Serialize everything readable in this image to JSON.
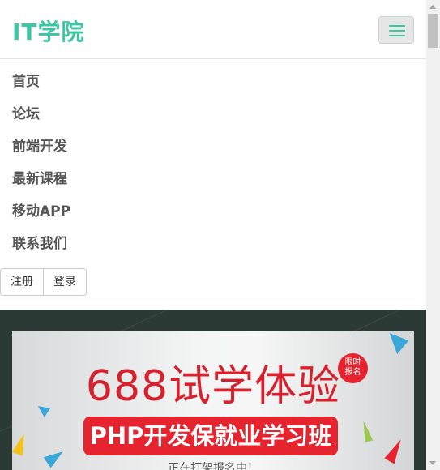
{
  "brand": {
    "title": "IT学院"
  },
  "navbar": {
    "toggle_label": ""
  },
  "menu": {
    "items": [
      {
        "label": "首页"
      },
      {
        "label": "论坛"
      },
      {
        "label": "前端开发"
      },
      {
        "label": "最新课程"
      },
      {
        "label": "移动APP"
      },
      {
        "label": "联系我们"
      }
    ]
  },
  "auth": {
    "register_label": "注册",
    "login_label": "登录"
  },
  "banner": {
    "headline": "688试学体验",
    "badge_line1": "限时",
    "badge_line2": "报名",
    "pill_text": "PHP开发保就业学习班",
    "subline": "正在打架报名中！"
  },
  "colors": {
    "brand": "#3cc6a4",
    "accent_red": "#e5242f",
    "banner_bg": "#2c3a36"
  }
}
